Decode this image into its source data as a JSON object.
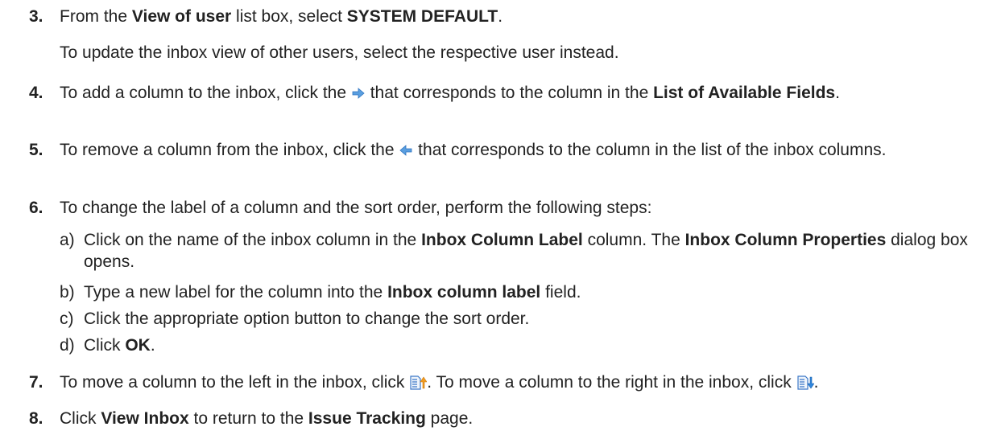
{
  "steps": [
    {
      "num": "3.",
      "t1": "From the ",
      "b1": "View of user",
      "t2": " list box, select ",
      "b2": "SYSTEM DEFAULT",
      "t3": ".",
      "note": "To update the inbox view of other users, select the respective user instead."
    },
    {
      "num": "4.",
      "t1": "To add a column to the inbox, click the ",
      "t2": " that corresponds to the column in the ",
      "b1": "List of Available Fields",
      "t3": "."
    },
    {
      "num": "5.",
      "t1": "To remove a column from the inbox, click the ",
      "t2": " that corresponds to the column in the list of the inbox columns."
    },
    {
      "num": "6.",
      "t1": "To change the label of a column and the sort order, perform the following steps:",
      "subs": [
        {
          "letter": "a)",
          "t1": "Click on the name of the inbox column in the ",
          "b1": "Inbox Column Label",
          "t2": " column. The ",
          "b2": "Inbox Column Properties",
          "t3": " dialog box opens."
        },
        {
          "letter": "b)",
          "t1": "Type a new label for the column into the ",
          "b1": "Inbox column label",
          "t2": " field."
        },
        {
          "letter": "c)",
          "t1": "Click the appropriate option button to change the sort order."
        },
        {
          "letter": "d)",
          "t1": "Click ",
          "b1": "OK",
          "t2": "."
        }
      ]
    },
    {
      "num": "7.",
      "t1": "To move a column to the left in the inbox, click ",
      "t2": ". To move a column to the right in the inbox, click ",
      "t3": "."
    },
    {
      "num": "8.",
      "t1": "Click ",
      "b1": "View Inbox",
      "t2": " to return to the ",
      "b2": "Issue Tracking",
      "t3": " page."
    }
  ],
  "icons": {
    "add": "arrow-right-icon",
    "remove": "arrow-left-icon",
    "move_left": "move-column-left-icon",
    "move_right": "move-column-right-icon"
  },
  "colors": {
    "text": "#222222",
    "arrow_blue": "#5a9fe0",
    "doc_blue": "#3c78c8"
  }
}
